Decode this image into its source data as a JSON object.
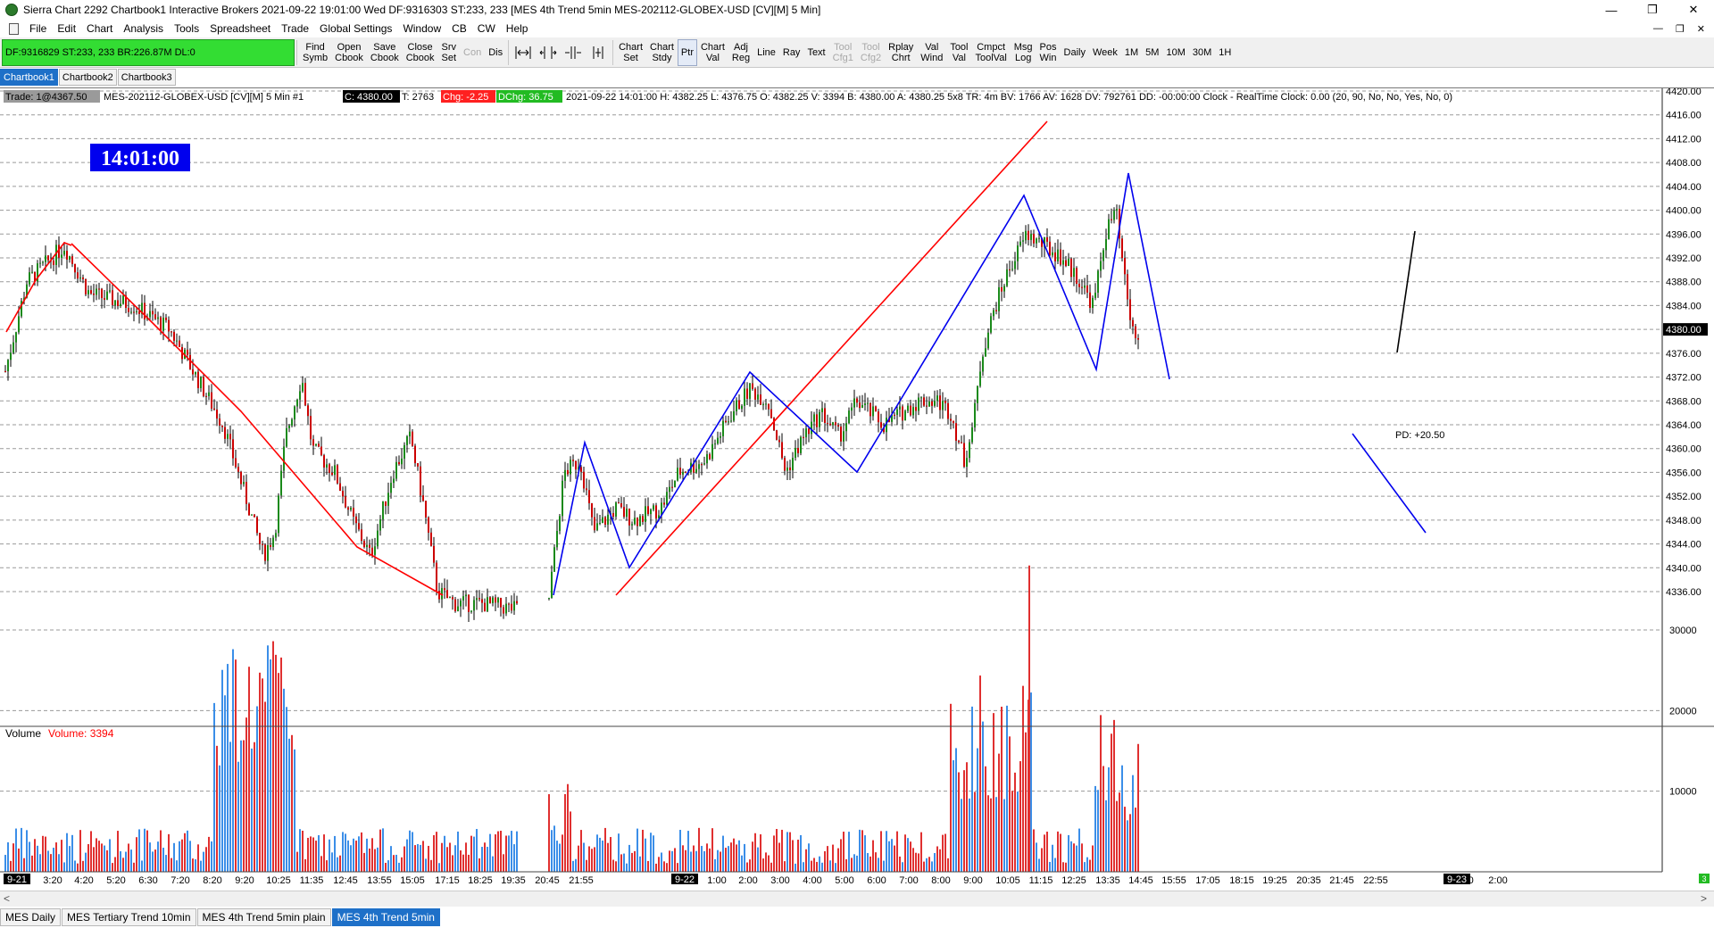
{
  "window": {
    "title": "Sierra Chart 2292 Chartbook1  Interactive Brokers 2021-09-22  19:01:00 Wed  DF:9316303  ST:233, 233  [MES 4th Trend 5min MES-202112-GLOBEX-USD [CV][M]  5 Min]",
    "minimize": "—",
    "maximize": "❐",
    "close": "✕"
  },
  "menu": {
    "items": [
      "File",
      "Edit",
      "Chart",
      "Analysis",
      "Tools",
      "Spreadsheet",
      "Trade",
      "Global Settings",
      "Window",
      "CB",
      "CW",
      "Help"
    ],
    "mdi_minimize": "—",
    "mdi_restore": "❐",
    "mdi_close": "✕"
  },
  "toolbar": {
    "account_status": "DF:9316829  ST:233, 233  BR:226.87M  DL:0",
    "buttons_a": [
      {
        "label": "Find\nSymb",
        "state": "normal"
      },
      {
        "label": "Open\nCbook",
        "state": "normal"
      },
      {
        "label": "Save\nCbook",
        "state": "normal"
      },
      {
        "label": "Close\nCbook",
        "state": "normal"
      },
      {
        "label": "Srv\nSet",
        "state": "normal"
      },
      {
        "label": "Con",
        "state": "disabled"
      },
      {
        "label": "Dis",
        "state": "normal"
      }
    ],
    "buttons_b": [
      {
        "label": "Chart\nSet",
        "state": "normal"
      },
      {
        "label": "Chart\nStdy",
        "state": "normal"
      },
      {
        "label": "Ptr",
        "state": "active"
      },
      {
        "label": "Chart\nVal",
        "state": "normal"
      },
      {
        "label": "Adj\nReg",
        "state": "normal"
      },
      {
        "label": "Line",
        "state": "normal"
      },
      {
        "label": "Ray",
        "state": "normal"
      },
      {
        "label": "Text",
        "state": "normal"
      },
      {
        "label": "Tool\nCfg1",
        "state": "disabled"
      },
      {
        "label": "Tool\nCfg2",
        "state": "disabled"
      },
      {
        "label": "Rplay\nChrt",
        "state": "normal"
      },
      {
        "label": "Val\nWind",
        "state": "normal"
      },
      {
        "label": "Tool\nVal",
        "state": "normal"
      },
      {
        "label": "Cmpct\nToolVal",
        "state": "normal"
      },
      {
        "label": "Msg\nLog",
        "state": "normal"
      },
      {
        "label": "Pos\nWin",
        "state": "normal"
      },
      {
        "label": "Daily",
        "state": "normal"
      },
      {
        "label": "Week",
        "state": "normal"
      },
      {
        "label": "1M",
        "state": "normal"
      },
      {
        "label": "5M",
        "state": "normal"
      },
      {
        "label": "10M",
        "state": "normal"
      },
      {
        "label": "30M",
        "state": "normal"
      },
      {
        "label": "1H",
        "state": "normal"
      }
    ]
  },
  "chartbook_tabs": [
    {
      "label": "Chartbook1",
      "active": true
    },
    {
      "label": "Chartbook2",
      "active": false
    },
    {
      "label": "Chartbook3",
      "active": false
    }
  ],
  "chart": {
    "header": {
      "trade": "Trade: 1@4367.50",
      "symbol": "MES-202112-GLOBEX-USD [CV][M]  5 Min  #1",
      "close": "C: 4380.00",
      "trades": "T: 2763",
      "chg": "Chg: -2.25",
      "dchg": "DChg: 36.75",
      "details": "2021-09-22 14:01:00 H: 4382.25 L: 4376.75 O: 4382.25 V: 3394 B: 4380.00 A: 4380.25 5x8 TR: 4m BV: 1766 AV: 1628 DV: 792761 DD: -00:00:00 Clock - RealTime  Clock: 0.00   (20, 90, No, No, Yes, No, 0)"
    },
    "clock": "14:01:00",
    "price_labels": [
      "4420.00",
      "4416.00",
      "4412.00",
      "4408.00",
      "4404.00",
      "4400.00",
      "4396.00",
      "4392.00",
      "4388.00",
      "4384.00",
      "4380.00",
      "4376.00",
      "4372.00",
      "4368.00",
      "4364.00",
      "4360.00",
      "4356.00",
      "4352.00",
      "4348.00",
      "4344.00",
      "4340.00",
      "4336.00"
    ],
    "current_price": "4380.00",
    "pd_label": "PD: +20.50",
    "volume": {
      "title": "Volume",
      "value": "Volume: 3394",
      "labels": [
        "30000",
        "20000",
        "10000"
      ]
    },
    "time_labels": [
      "3:20",
      "4:20",
      "5:20",
      "6:30",
      "7:20",
      "8:20",
      "9:20",
      "10:25",
      "11:35",
      "12:45",
      "13:55",
      "15:05",
      "17:15",
      "18:25",
      "19:35",
      "20:45",
      "21:55",
      "1:00",
      "2:00",
      "3:00",
      "4:00",
      "5:00",
      "6:00",
      "7:00",
      "8:00",
      "9:00",
      "10:05",
      "11:15",
      "12:25",
      "13:35",
      "14:45",
      "15:55",
      "17:05",
      "18:15",
      "19:25",
      "20:35",
      "21:45",
      "22:55",
      "1:00",
      "2:00"
    ],
    "date_markers": [
      "9-21",
      "9-22",
      "9-23"
    ],
    "corner_badge": "3",
    "colors": {
      "up": "#1a8a1a",
      "down": "#cc0000",
      "vol_up": "#3b8ee8",
      "vol_down": "#e03030",
      "trend_red": "#ff0000",
      "trend_blue": "#0000ee",
      "clock_bg": "#0000ee"
    }
  },
  "chart_tabs": [
    {
      "label": "MES Daily",
      "active": false
    },
    {
      "label": "MES Tertiary Trend 10min",
      "active": false
    },
    {
      "label": "MES 4th Trend 5min plain",
      "active": false
    },
    {
      "label": "MES 4th Trend 5min",
      "active": true
    }
  ]
}
